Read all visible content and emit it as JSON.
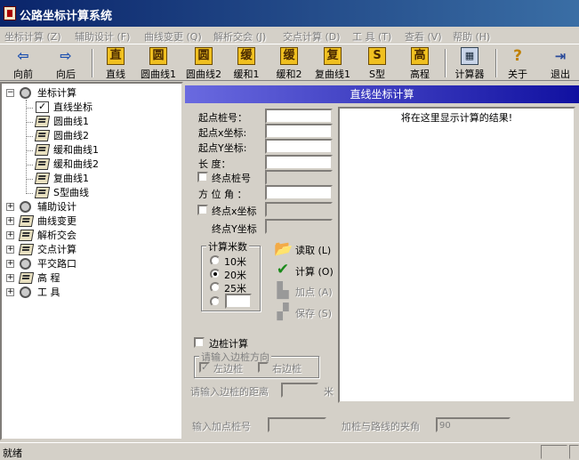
{
  "window": {
    "title": "公路坐标计算系统"
  },
  "menu": [
    "坐标计算 (Z)",
    "辅助设计 (F)",
    "曲线变更 (Q)",
    "解析交会 (J)",
    "交点计算 (D)",
    "工 具 (T)",
    "查看 (V)",
    "帮助 (H)"
  ],
  "toolbar": {
    "back": "向前",
    "forward": "向后",
    "tools": [
      {
        "glyph": "直",
        "label": "直线"
      },
      {
        "glyph": "圆",
        "label": "圆曲线1"
      },
      {
        "glyph": "圆",
        "label": "圆曲线2"
      },
      {
        "glyph": "缓",
        "label": "缓和1"
      },
      {
        "glyph": "缓",
        "label": "缓和2"
      },
      {
        "glyph": "复",
        "label": "复曲线1"
      },
      {
        "glyph": "S",
        "label": "S型"
      },
      {
        "glyph": "高",
        "label": "高程"
      }
    ],
    "calculator": "计算器",
    "about": "关于",
    "exit": "退出"
  },
  "tree": {
    "root": "坐标计算",
    "children": [
      "直线坐标",
      "圆曲线1",
      "圆曲线2",
      "缓和曲线1",
      "缓和曲线2",
      "复曲线1",
      "S型曲线"
    ],
    "others": [
      "辅助设计",
      "曲线变更",
      "解析交会",
      "交点计算",
      "平交路口",
      "高 程",
      "工 具"
    ]
  },
  "panel": {
    "title": "直线坐标计算",
    "fields": {
      "start_station": "起点桩号：",
      "start_x": "起点x坐标:",
      "start_y": "起点Y坐标:",
      "length": "长    度：",
      "end_station": "终点桩号",
      "azimuth": "方 位 角 ：",
      "end_x": "终点x坐标",
      "end_y": "终点Y坐标"
    },
    "count_group": "计算米数",
    "radios": [
      "10米",
      "20米",
      "25米"
    ],
    "actions": {
      "read": "读取 (L)",
      "calc": "计算 (O)",
      "add": "加点 (A)",
      "save": "保存 (S)"
    },
    "side_pile": "边桩计算",
    "side_dir_group": "请输入边桩方向",
    "left_pile": "左边桩",
    "right_pile": "右边桩",
    "side_distance": "请输入边桩的距离",
    "meter_unit": "米",
    "add_station": "输入加点桩号",
    "angle_label": "加桩与路线的夹角",
    "angle_value": "90",
    "result_text": "将在这里显示计算的结果!"
  },
  "status": {
    "text": "就绪"
  }
}
